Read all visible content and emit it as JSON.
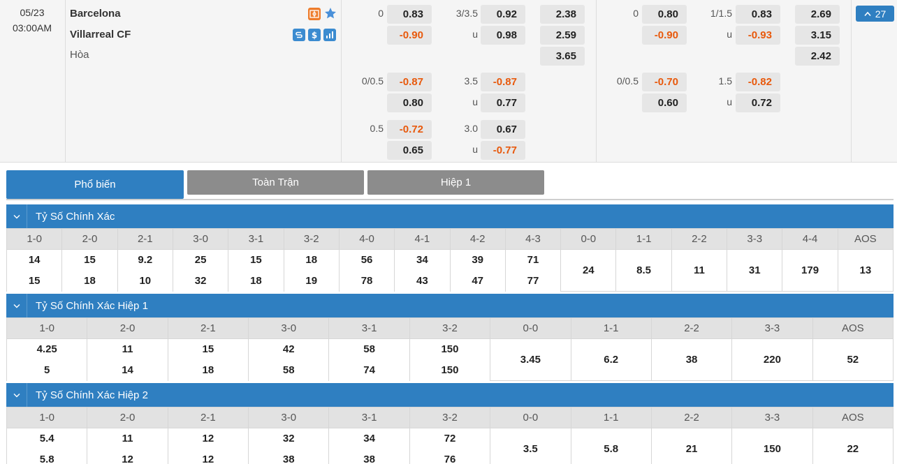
{
  "match": {
    "date": "05/23",
    "time": "03:00AM",
    "home": "Barcelona",
    "away": "Villarreal CF",
    "draw_label": "Hòa",
    "more_count": "27",
    "icons": [
      "field-icon",
      "star-icon",
      "stats-s-icon",
      "dollar-icon",
      "bar-chart-icon"
    ]
  },
  "odds_left": {
    "handicap": {
      "rows": [
        {
          "label": "0",
          "value": "0.83",
          "neg": false
        },
        {
          "label": "",
          "value": "-0.90",
          "neg": true
        },
        {
          "label": "0/0.5",
          "value": "-0.87",
          "neg": true
        },
        {
          "label": "",
          "value": "0.80",
          "neg": false
        },
        {
          "label": "0.5",
          "value": "-0.72",
          "neg": true
        },
        {
          "label": "",
          "value": "0.65",
          "neg": false
        }
      ]
    },
    "overunder": {
      "rows": [
        {
          "label": "3/3.5",
          "value": "0.92",
          "neg": false
        },
        {
          "label": "u",
          "value": "0.98",
          "neg": false
        },
        {
          "label": "3.5",
          "value": "-0.87",
          "neg": true
        },
        {
          "label": "u",
          "value": "0.77",
          "neg": false
        },
        {
          "label": "3.0",
          "value": "0.67",
          "neg": false
        },
        {
          "label": "u",
          "value": "-0.77",
          "neg": true
        }
      ]
    },
    "x12": [
      "2.38",
      "2.59",
      "3.65"
    ]
  },
  "odds_right": {
    "handicap": {
      "rows": [
        {
          "label": "0",
          "value": "0.80",
          "neg": false
        },
        {
          "label": "",
          "value": "-0.90",
          "neg": true
        },
        {
          "label": "0/0.5",
          "value": "-0.70",
          "neg": true
        },
        {
          "label": "",
          "value": "0.60",
          "neg": false
        }
      ]
    },
    "overunder": {
      "rows": [
        {
          "label": "1/1.5",
          "value": "0.83",
          "neg": false
        },
        {
          "label": "u",
          "value": "-0.93",
          "neg": true
        },
        {
          "label": "1.5",
          "value": "-0.82",
          "neg": true
        },
        {
          "label": "u",
          "value": "0.72",
          "neg": false
        }
      ]
    },
    "x12": [
      "2.69",
      "3.15",
      "2.42"
    ]
  },
  "tabs": [
    {
      "label": "Phổ biến",
      "active": true
    },
    {
      "label": "Toàn Trận",
      "active": false
    },
    {
      "label": "Hiệp 1",
      "active": false
    }
  ],
  "sections": [
    {
      "title": "Tỷ Số Chính Xác",
      "columns": [
        "1-0",
        "2-0",
        "2-1",
        "3-0",
        "3-1",
        "3-2",
        "4-0",
        "4-1",
        "4-2",
        "4-3",
        "0-0",
        "1-1",
        "2-2",
        "3-3",
        "4-4",
        "AOS"
      ],
      "row1": [
        "14",
        "15",
        "9.2",
        "25",
        "15",
        "18",
        "56",
        "34",
        "39",
        "71",
        "24",
        "8.5",
        "11",
        "31",
        "179",
        "13"
      ],
      "row2": [
        "15",
        "18",
        "10",
        "32",
        "18",
        "19",
        "78",
        "43",
        "47",
        "77",
        "",
        "",
        "",
        "",
        "",
        ""
      ],
      "split_count": 10
    },
    {
      "title": "Tỷ Số Chính Xác Hiệp 1",
      "columns": [
        "1-0",
        "2-0",
        "2-1",
        "3-0",
        "3-1",
        "3-2",
        "0-0",
        "1-1",
        "2-2",
        "3-3",
        "AOS"
      ],
      "row1": [
        "4.25",
        "11",
        "15",
        "42",
        "58",
        "150",
        "3.45",
        "6.2",
        "38",
        "220",
        "52"
      ],
      "row2": [
        "5",
        "14",
        "18",
        "58",
        "74",
        "150",
        "",
        "",
        "",
        "",
        ""
      ],
      "split_count": 6
    },
    {
      "title": "Tỷ Số Chính Xác Hiệp 2",
      "columns": [
        "1-0",
        "2-0",
        "2-1",
        "3-0",
        "3-1",
        "3-2",
        "0-0",
        "1-1",
        "2-2",
        "3-3",
        "AOS"
      ],
      "row1": [
        "5.4",
        "11",
        "12",
        "32",
        "34",
        "72",
        "3.5",
        "5.8",
        "21",
        "150",
        "22"
      ],
      "row2": [
        "5.8",
        "12",
        "12",
        "38",
        "38",
        "76",
        "",
        "",
        "",
        "",
        ""
      ],
      "split_count": 6
    }
  ],
  "colors": {
    "accent": "#2f7fc1",
    "negative": "#e8590c",
    "tab_inactive": "#8c8c8c",
    "icon_orange": "#ee7c2b"
  }
}
